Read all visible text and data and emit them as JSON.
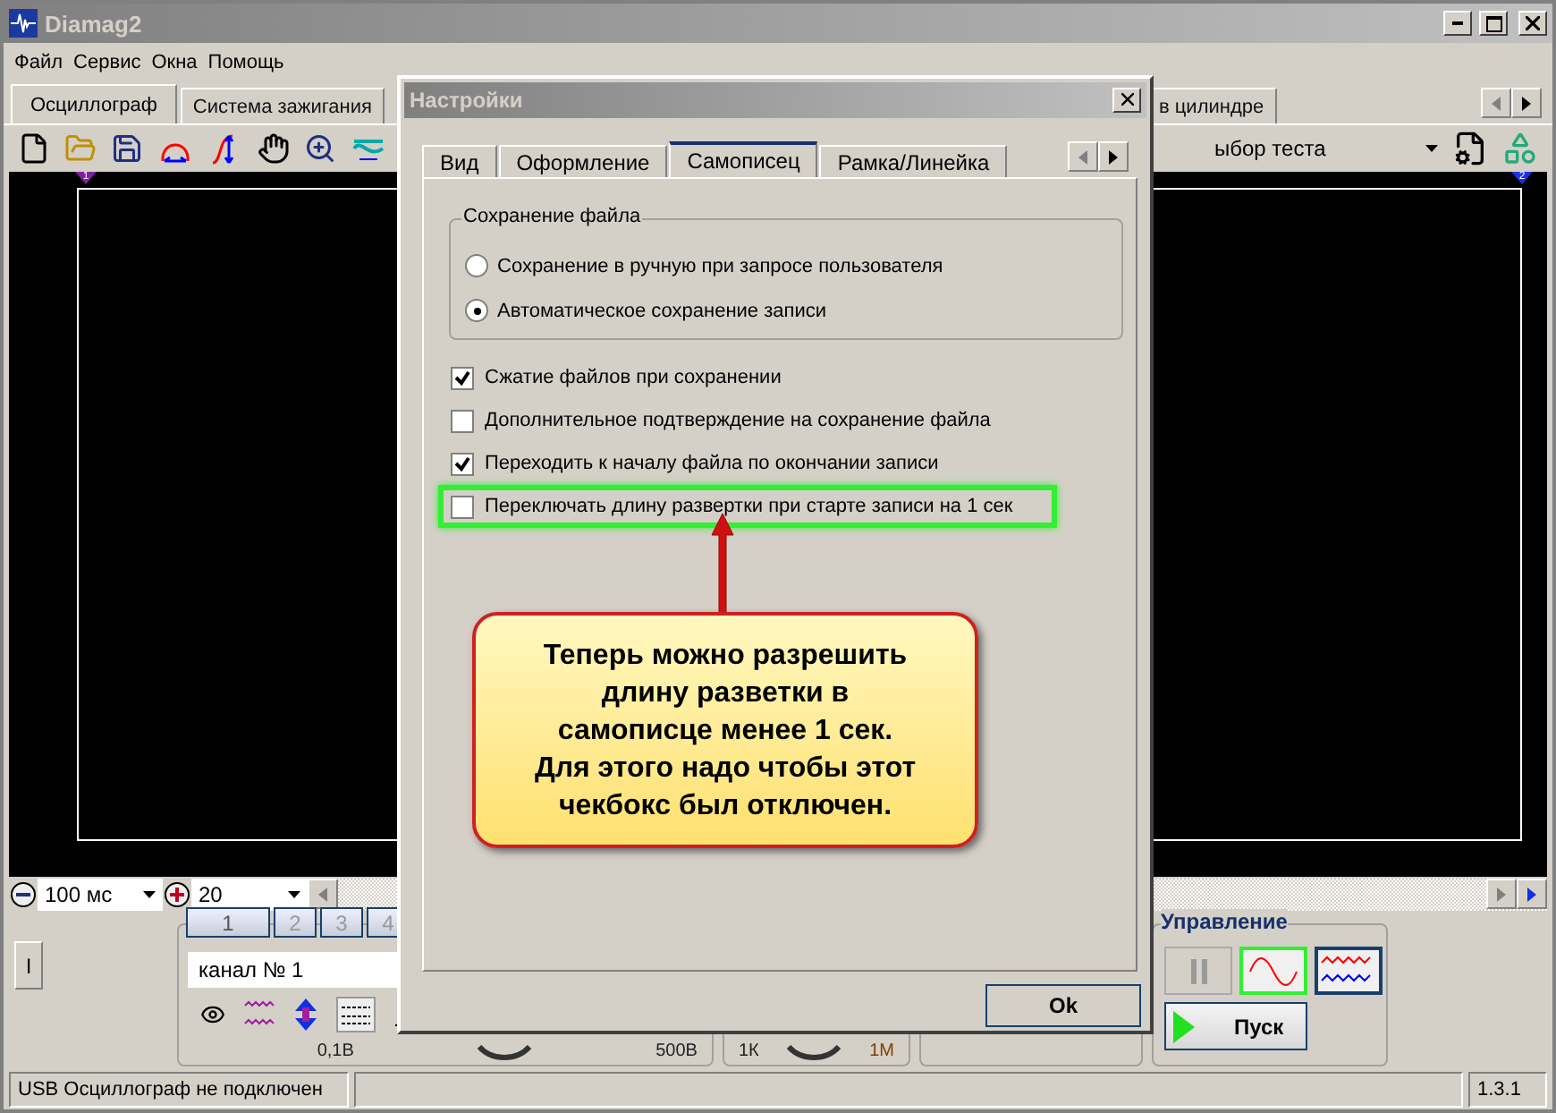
{
  "window": {
    "title": "Diamag2"
  },
  "menu": [
    "Файл",
    "Сервис",
    "Окна",
    "Помощь"
  ],
  "tabs": [
    {
      "label": "Осциллограф",
      "selected": true
    },
    {
      "label": "Система зажигания",
      "selected": false
    },
    {
      "label": "в цилиндре",
      "selected": false
    }
  ],
  "toolbar": {
    "test_select": "ыбор теста"
  },
  "scope": {
    "markers": [
      "1",
      "2"
    ]
  },
  "timebase": "100 мс",
  "scale": "20",
  "channel_panel": {
    "toggle": "I",
    "channel_tabs": [
      {
        "label": "1",
        "selected": true
      },
      {
        "label": "2",
        "selected": false
      },
      {
        "label": "3",
        "selected": false
      },
      {
        "label": "4",
        "selected": false
      }
    ],
    "channel_name": "канал № 1",
    "range_min": "0,1В",
    "range_max": "500В",
    "res_min": "1К",
    "res_max": "1М"
  },
  "control": {
    "title": "Управление",
    "start": "Пуск",
    "sine_selected": true
  },
  "status_bar": {
    "message": "USB Осциллограф не подключен",
    "version": "1.3.1"
  },
  "dialog": {
    "title": "Настройки",
    "tabs": [
      {
        "label": "Вид",
        "selected": false
      },
      {
        "label": "Оформление",
        "selected": false
      },
      {
        "label": "Самописец",
        "selected": true
      },
      {
        "label": "Рамка/Линейка",
        "selected": false
      }
    ],
    "group": {
      "title": "Сохранение файла",
      "options": [
        {
          "label": "Сохранение в ручную при запросе пользователя",
          "selected": false
        },
        {
          "label": "Автоматическое сохранение записи",
          "selected": true
        }
      ]
    },
    "checkboxes": [
      {
        "label": "Сжатие файлов при сохранении",
        "checked": true,
        "highlighted": false
      },
      {
        "label": "Дополнительное подтверждение на сохранение файла",
        "checked": false,
        "highlighted": false
      },
      {
        "label": "Переходить к началу  файла по окончании записи",
        "checked": true,
        "highlighted": false
      },
      {
        "label": "Переключать длину развертки при старте записи на 1 сек",
        "checked": false,
        "highlighted": true
      }
    ],
    "ok": "Ok"
  },
  "callout": {
    "text": "Теперь можно разрешить длину разветки в самописце менее 1 сек. Для этого надо чтобы этот чекбокс был отключен."
  }
}
